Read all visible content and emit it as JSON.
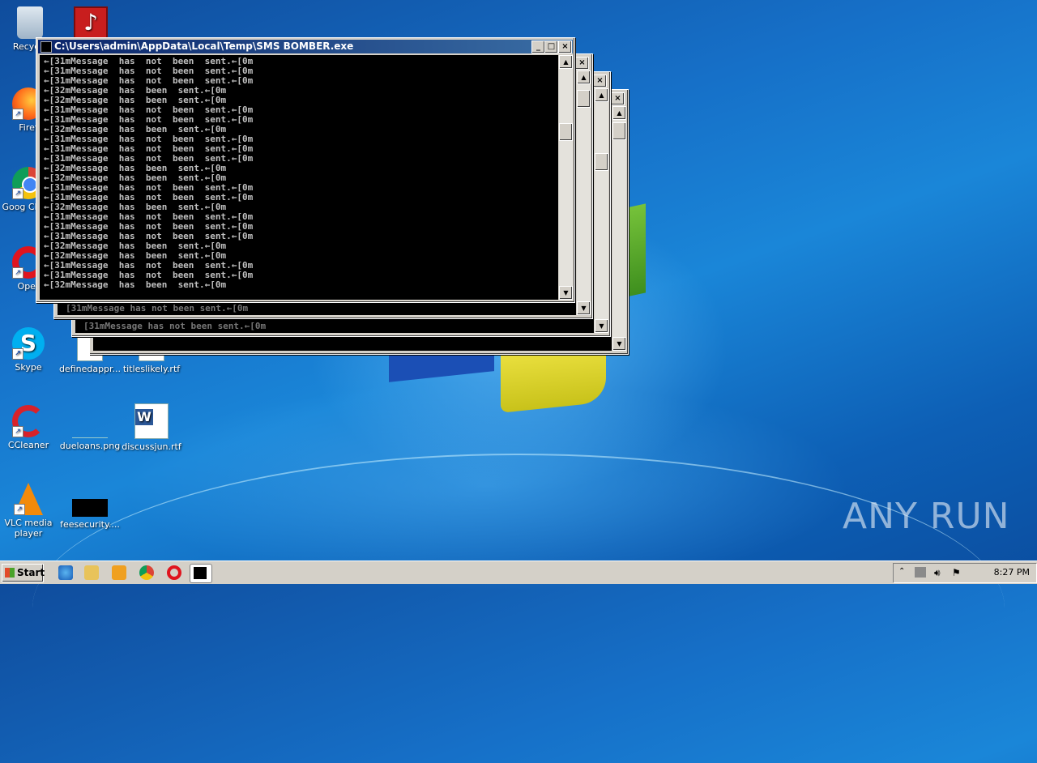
{
  "desktop": {
    "icons": [
      {
        "label": "Recycle",
        "icon": "recycle-bin-icon"
      },
      {
        "label": "Firef",
        "icon": "firefox-icon"
      },
      {
        "label": "Goog Chron",
        "icon": "chrome-icon"
      },
      {
        "label": "Oper",
        "icon": "opera-icon"
      },
      {
        "label": "Skype",
        "icon": "skype-icon"
      },
      {
        "label": "definedappr...",
        "icon": "document-icon"
      },
      {
        "label": "titleslikely.rtf",
        "icon": "rtf-icon"
      },
      {
        "label": "CCleaner",
        "icon": "ccleaner-icon"
      },
      {
        "label": "dueloans.png",
        "icon": "image-icon"
      },
      {
        "label": "discussjun.rtf",
        "icon": "word-icon"
      },
      {
        "label": "VLC media player",
        "icon": "vlc-icon"
      },
      {
        "label": "feesecurity....",
        "icon": "image-icon"
      }
    ]
  },
  "console": {
    "title": "C:\\Users\\admin\\AppData\\Local\\Temp\\SMS BOMBER.exe",
    "lines": [
      "←[31mMessage has not been sent.←[0m",
      "←[31mMessage has not been sent.←[0m",
      "←[31mMessage has not been sent.←[0m",
      "←[32mMessage has been sent.←[0m",
      "←[32mMessage has been sent.←[0m",
      "←[31mMessage has not been sent.←[0m",
      "←[31mMessage has not been sent.←[0m",
      "←[32mMessage has been sent.←[0m",
      "←[31mMessage has not been sent.←[0m",
      "←[31mMessage has not been sent.←[0m",
      "←[31mMessage has not been sent.←[0m",
      "←[32mMessage has been sent.←[0m",
      "←[32mMessage has been sent.←[0m",
      "←[31mMessage has not been sent.←[0m",
      "←[31mMessage has not been sent.←[0m",
      "←[32mMessage has been sent.←[0m",
      "←[31mMessage has not been sent.←[0m",
      "←[31mMessage has not been sent.←[0m",
      "←[31mMessage has not been sent.←[0m",
      "←[32mMessage has been sent.←[0m",
      "←[32mMessage has been sent.←[0m",
      "←[31mMessage has not been sent.←[0m",
      "←[31mMessage has not been sent.←[0m",
      "←[32mMessage has been sent.←[0m"
    ],
    "back_line": "[31mMessage has not been sent.←[0m"
  },
  "taskbar": {
    "start_label": "Start",
    "clock": "8:27 PM"
  },
  "watermark": "ANY RUN"
}
